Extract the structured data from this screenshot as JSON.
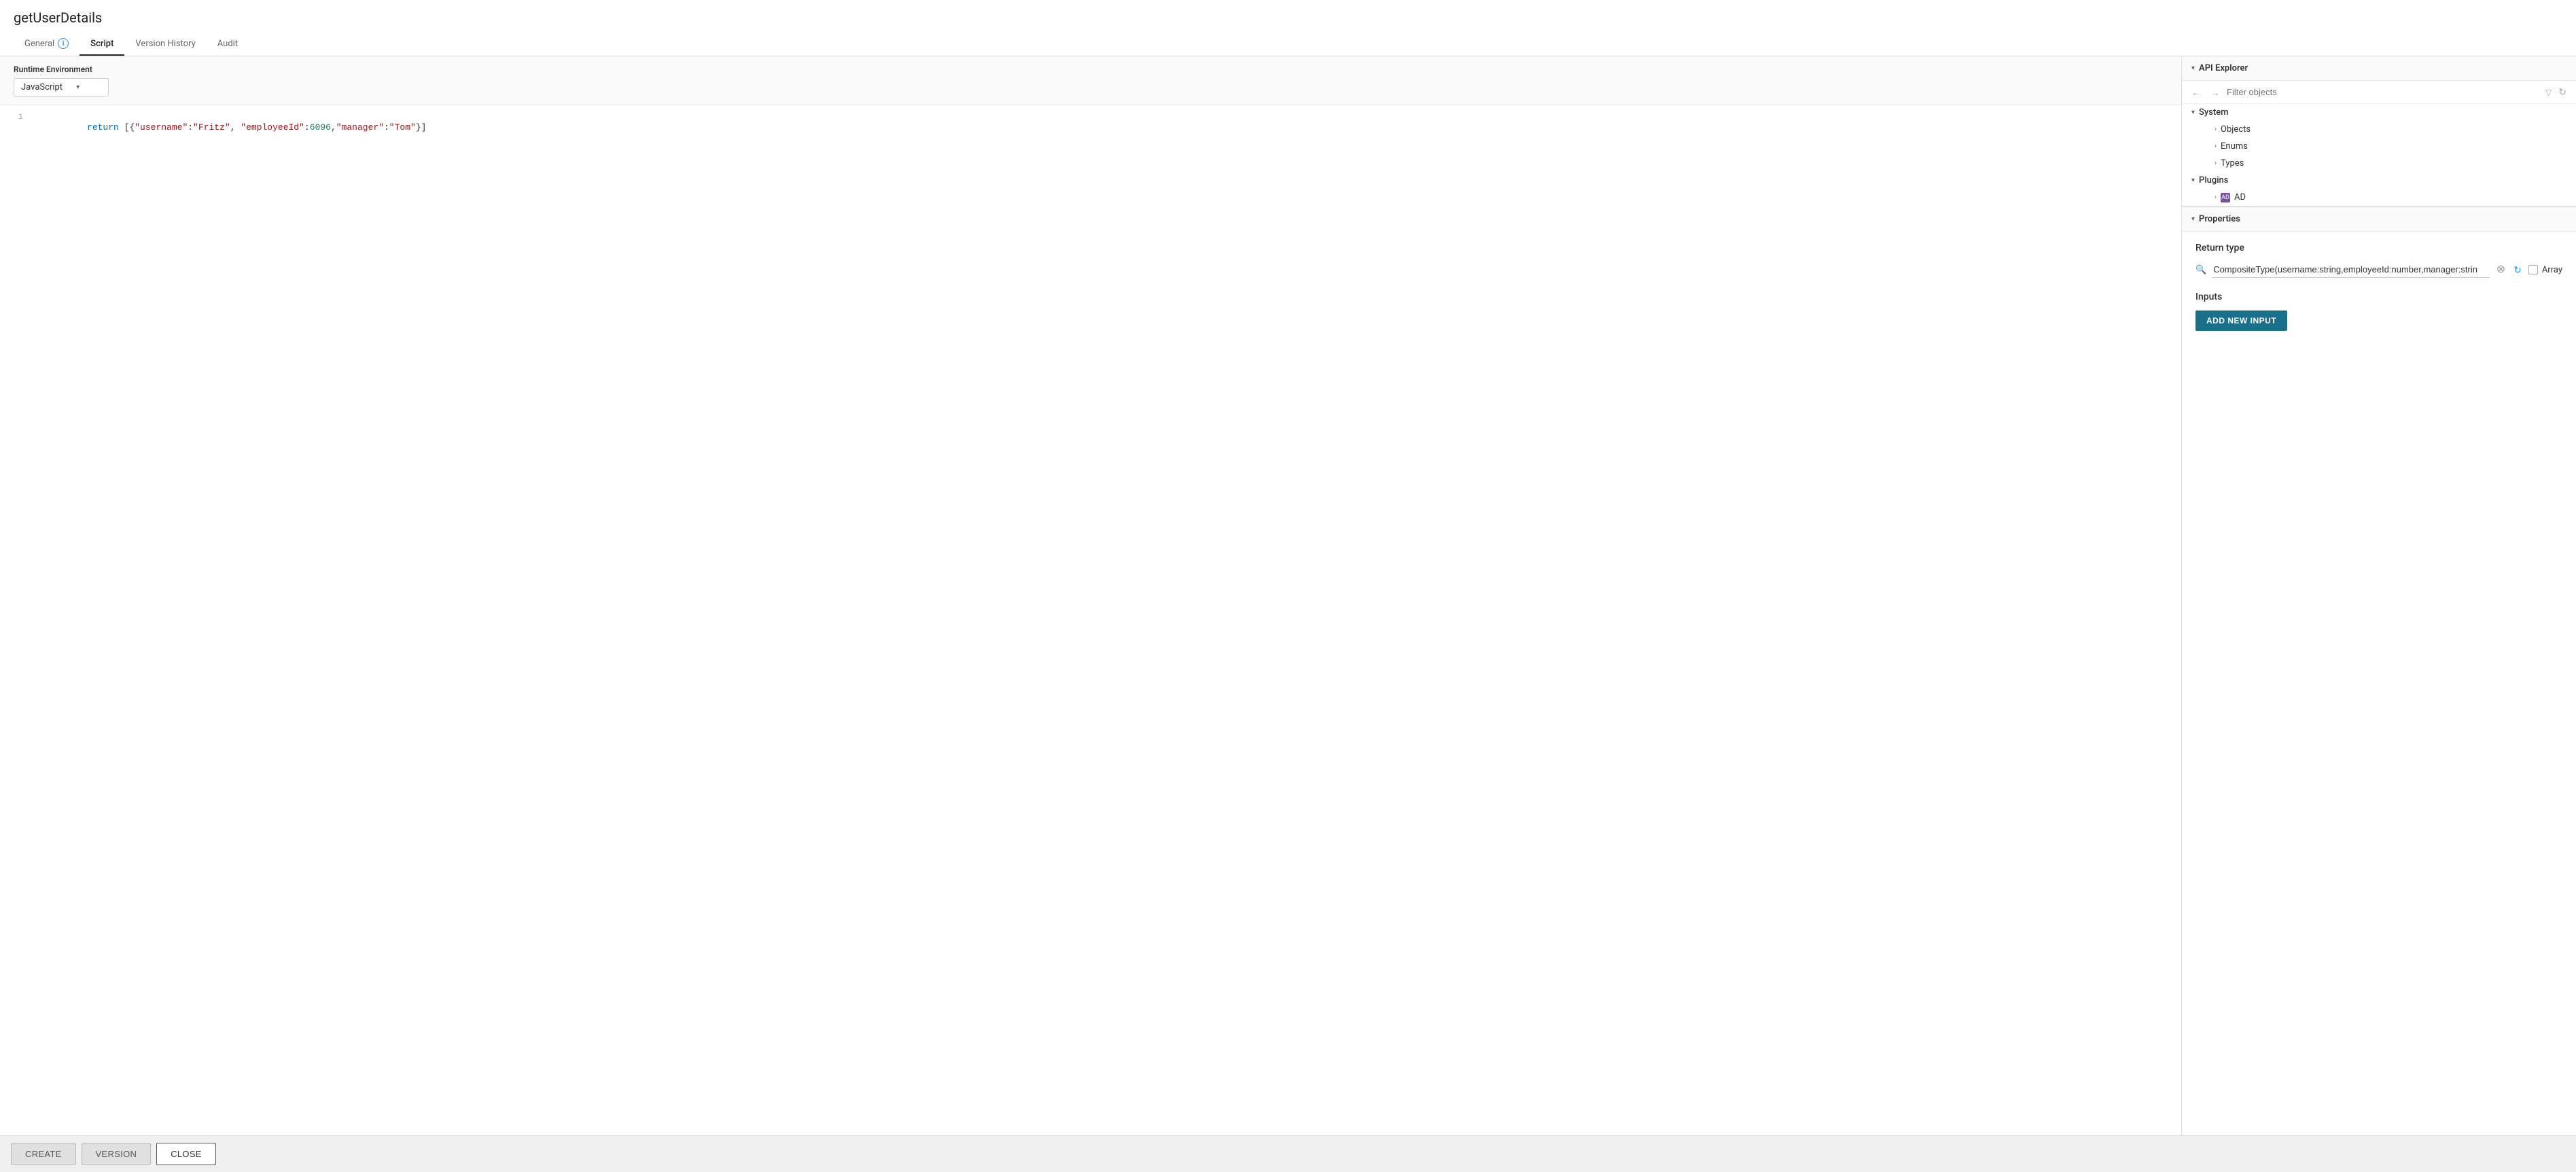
{
  "page": {
    "title": "getUserDetails"
  },
  "tabs": [
    {
      "id": "general",
      "label": "General",
      "active": false,
      "hasInfo": true
    },
    {
      "id": "script",
      "label": "Script",
      "active": true,
      "hasInfo": false
    },
    {
      "id": "version-history",
      "label": "Version History",
      "active": false,
      "hasInfo": false
    },
    {
      "id": "audit",
      "label": "Audit",
      "active": false,
      "hasInfo": false
    }
  ],
  "editor": {
    "runtime_label": "Runtime Environment",
    "runtime_value": "JavaScript",
    "code_line": "return [{\"username\":\"Fritz\", \"employeeId\":6096,\"manager\":\"Tom\"}]"
  },
  "api_explorer": {
    "title": "API Explorer",
    "filter_placeholder": "Filter objects",
    "tree": [
      {
        "level": 0,
        "type": "section",
        "label": "System",
        "expanded": true
      },
      {
        "level": 1,
        "type": "item",
        "label": "Objects"
      },
      {
        "level": 1,
        "type": "item",
        "label": "Enums"
      },
      {
        "level": 1,
        "type": "item",
        "label": "Types"
      },
      {
        "level": 0,
        "type": "section",
        "label": "Plugins",
        "expanded": true
      },
      {
        "level": 1,
        "type": "plugin",
        "label": "AD"
      }
    ]
  },
  "properties": {
    "section_title": "Properties",
    "return_type_label": "Return type",
    "return_type_value": "CompositeType(username:string,employeeId:number,manager:strin",
    "array_label": "Array",
    "inputs_label": "Inputs",
    "add_input_btn": "ADD NEW INPUT"
  },
  "footer": {
    "create_label": "CREATE",
    "version_label": "VERSION",
    "close_label": "CLOSE"
  }
}
